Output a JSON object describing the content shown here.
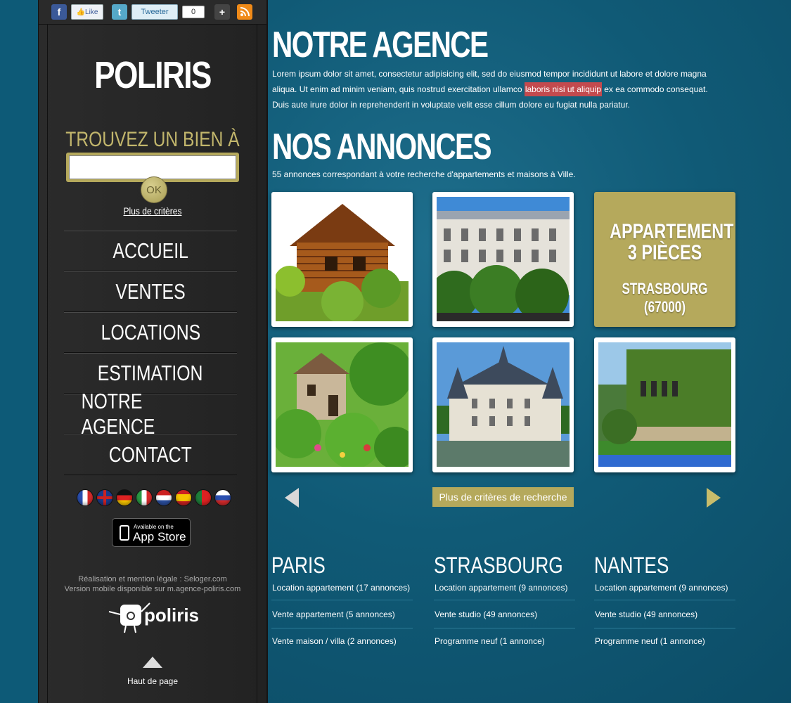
{
  "social": {
    "like_label": "Like",
    "tweet_label": "Tweeter",
    "tweet_count": "0"
  },
  "sidebar": {
    "logo": "POLIRIS",
    "search_title": "TROUVEZ UN BIEN À",
    "ok_label": "OK",
    "more_criteria": "Plus de critères",
    "nav": [
      "ACCUEIL",
      "VENTES",
      "LOCATIONS",
      "ESTIMATION",
      "NOTRE AGENCE",
      "CONTACT"
    ],
    "languages": [
      "fr",
      "en",
      "de",
      "it",
      "nl",
      "es",
      "pt",
      "ru"
    ],
    "appstore_small": "Available on the",
    "appstore_big": "App Store",
    "credit_line1": "Réalisation et mention légale : Seloger.com",
    "credit_line2": "Version mobile disponible sur m.agence-poliris.com",
    "footer_logo": "poliris",
    "back_to_top": "Haut de page"
  },
  "main": {
    "agency_title": "NOTRE AGENCE",
    "intro_before": "Lorem ipsum dolor sit amet, consectetur adipisicing elit, sed do eiusmod tempor incididunt ut labore et dolore magna aliqua. Ut enim ad minim veniam, quis nostrud exercitation ullamco ",
    "intro_highlight": "laboris nisi ut aliquip",
    "intro_after": " ex ea commodo consequat. Duis aute irure dolor in reprehenderit in voluptate velit esse cillum dolore eu fugiat nulla pariatur.",
    "listings_title": "NOS ANNONCES",
    "listings_count": "55 annonces correspondant à votre recherche d'appartements et maisons à Ville.",
    "featured": {
      "type_line1": "APPARTEMENT",
      "type_line2": "3 PIÈCES",
      "location": "STRASBOURG (67000)"
    },
    "more_search_button": "Plus de critères de recherche"
  },
  "cities": [
    {
      "name": "PARIS",
      "links": [
        "Location appartement (17 annonces)",
        "Vente appartement (5 annonces)",
        "Vente maison / villa (2 annonces)"
      ]
    },
    {
      "name": "STRASBOURG",
      "links": [
        "Location appartement (9 annonces)",
        "Vente studio (49 annonces)",
        "Programme neuf (1 annonce)"
      ]
    },
    {
      "name": "NANTES",
      "links": [
        "Location appartement (9 annonces)",
        "Vente studio (49 annonces)",
        "Programme neuf (1 annonce)"
      ]
    }
  ],
  "colors": {
    "accent_gold": "#b5a95c",
    "background_blue": "#105a76",
    "sidebar_dark": "#262626",
    "highlight_red": "#c34a4e"
  }
}
